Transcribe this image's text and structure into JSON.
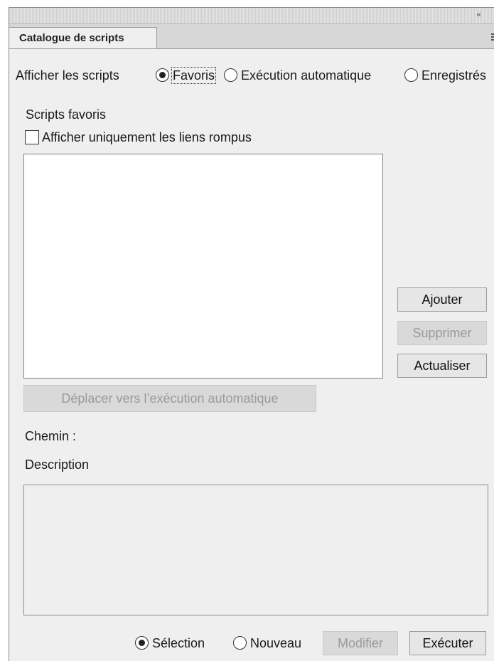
{
  "window": {
    "collapse_glyph": "«",
    "close_glyph": "×"
  },
  "tab": {
    "label": "Catalogue de scripts"
  },
  "filter": {
    "label": "Afficher les scripts",
    "options": [
      "Favoris",
      "Exécution automatique",
      "Enregistrés"
    ],
    "selected": "Favoris"
  },
  "favorites": {
    "heading": "Scripts favoris",
    "broken_links_label": "Afficher uniquement les liens rompus",
    "broken_links_checked": false,
    "items": []
  },
  "side_buttons": {
    "add": "Ajouter",
    "remove": "Supprimer",
    "refresh": "Actualiser"
  },
  "move_button": "Déplacer vers l’exécution automatique",
  "path_label": "Chemin :",
  "description_label": "Description",
  "bottom": {
    "options": [
      "Sélection",
      "Nouveau"
    ],
    "selected": "Sélection",
    "modify": "Modifier",
    "run": "Exécuter"
  },
  "icons": {
    "menu": "panel-menu-icon",
    "collapse": "collapse-icon",
    "close": "close-icon"
  }
}
